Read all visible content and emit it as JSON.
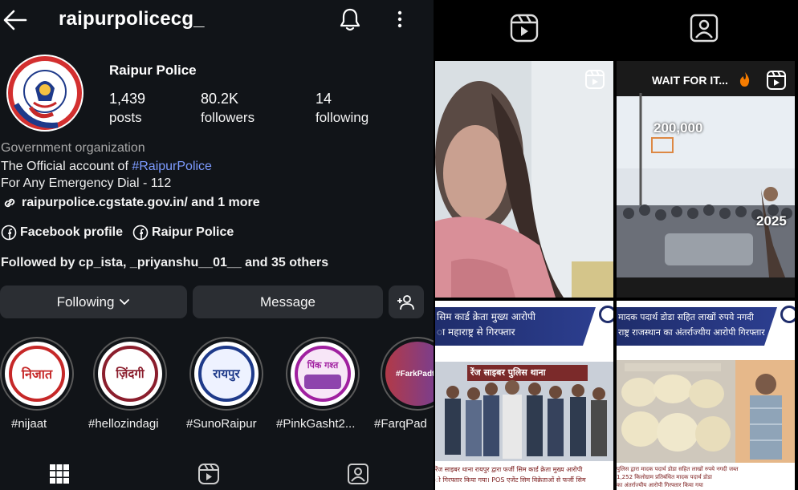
{
  "header": {
    "username": "raipurpolicecg_"
  },
  "profile": {
    "display_name": "Raipur Police",
    "stats": [
      {
        "value": "1,439",
        "label": "posts"
      },
      {
        "value": "80.2K",
        "label": "followers"
      },
      {
        "value": "14",
        "label": "following"
      }
    ],
    "category": "Government organization",
    "bio_prefix": "The Official account of ",
    "bio_hashtag": "#RaipurPolice",
    "bio_line2": "For Any Emergency Dial - 112",
    "link_text": "raipurpolice.cgstate.gov.in/ and 1 more",
    "facebook_profile": "Facebook profile",
    "facebook_page": "Raipur Police",
    "followed_by": "Followed by cp_ista, _priyanshu__01__ and 35 others"
  },
  "actions": {
    "following_label": "Following",
    "message_label": "Message"
  },
  "highlights": [
    {
      "caption": "#nijaat",
      "logo_text": "निजात"
    },
    {
      "caption": "#hellozindagi",
      "logo_text": "ज़िंदगी"
    },
    {
      "caption": "#SunoRaipur",
      "logo_text": "रायपुर"
    },
    {
      "caption": "#PinkGasht2...",
      "logo_text": "पिंक गश्त"
    },
    {
      "caption": "#FarqPad",
      "logo_text": "#FarkPadta"
    }
  ],
  "grid": {
    "tile2_caption": "WAIT FOR IT...",
    "tile2_top_number": "200,000",
    "tile2_year": "2025",
    "tile3_headline": [
      "सिम कार्ड क्रेता मुख्य आरोपी",
      "ा महाराष्ट्र से गिरफ्तार"
    ],
    "tile3_banner": "रेंज साइबर पुलिस थाना",
    "tile3_footer": [
      "रेंज साइबर थाना रायपुर द्वारा फर्जी सिम कार्ड क्रेता मुख्य आरोपी",
      "ो गिरफ्तार किया गया। POS एजेंट सिम विक्रेताओं से फर्जी सिम"
    ],
    "tile4_headline": [
      "मादक पदार्थ डोडा सहित लाखों रुपये नगदी",
      "राष्ट्र राजस्थान का अंतर्राज्यीय आरोपी गिरफ्तार"
    ],
    "tile4_footer": [
      "पुलिस द्वारा मादक पदार्थ डोडा सहित लाखों रुपये नगदी जब्त",
      "1,252 किलोग्राम प्रतिबंधित मादक पदार्थ डोडा",
      "का अंतर्राज्यीय आरोपी गिरफ्तार किया गया"
    ]
  },
  "icons": [
    "back-arrow-icon",
    "bell-icon",
    "more-icon",
    "link-icon",
    "facebook-icon",
    "chevron-down-icon",
    "add-person-icon",
    "grid-icon",
    "reels-icon",
    "tagged-icon"
  ],
  "colors": {
    "background": "#111418",
    "button": "#2b2e33",
    "hashtag": "#7d9bff",
    "muted": "#a8a8a8"
  }
}
